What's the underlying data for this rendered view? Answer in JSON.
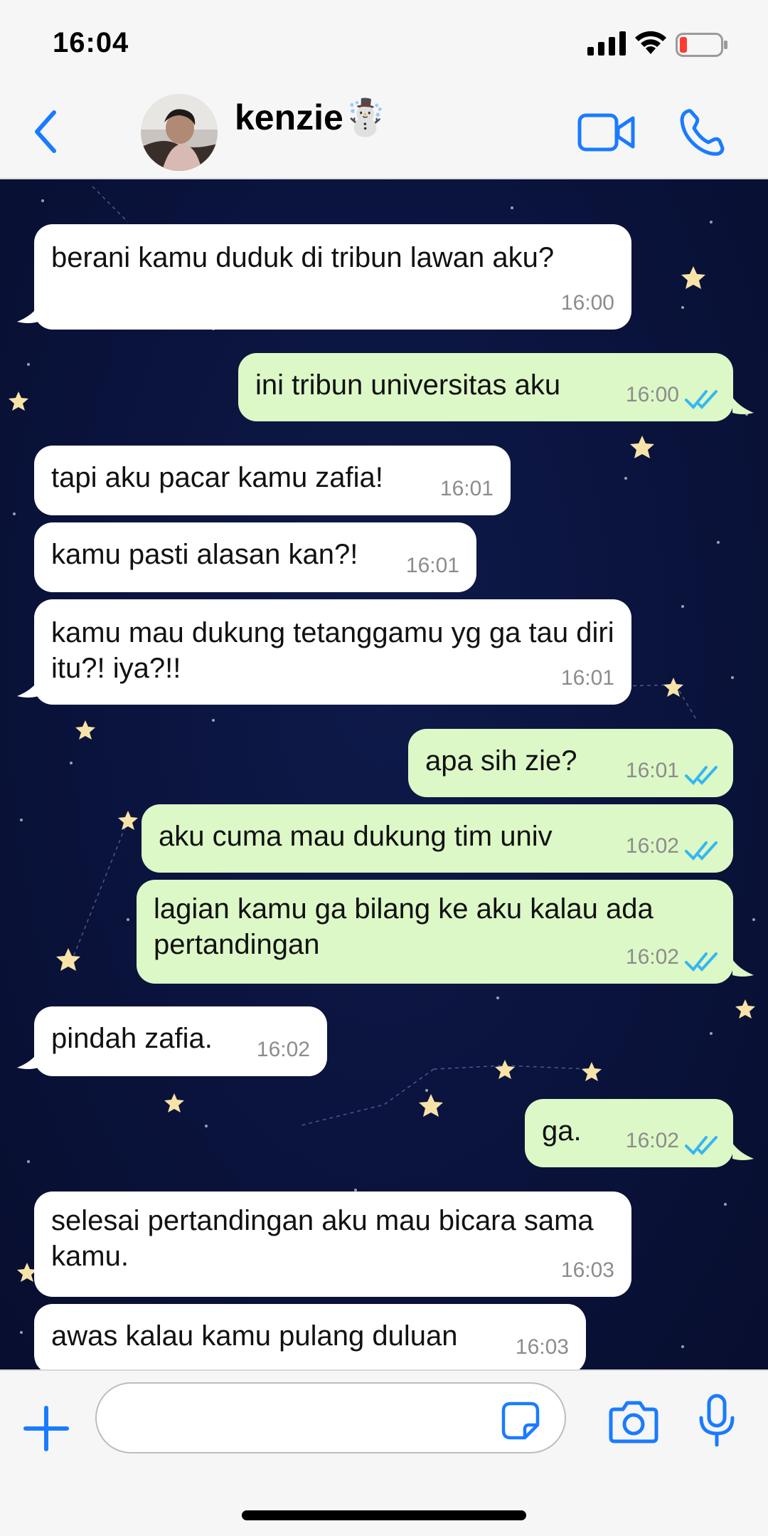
{
  "status": {
    "time": "16:04"
  },
  "header": {
    "contact_name": "kenzie☃️"
  },
  "colors": {
    "accent": "#1a7bff",
    "incoming": "#ffffff",
    "outgoing": "#dcf8c6",
    "read_ticks": "#34b7f1",
    "wallpaper": "#0a133c"
  },
  "messages": [
    {
      "dir": "in",
      "text": "berani kamu duduk di tribun lawan aku?",
      "time": "16:00"
    },
    {
      "dir": "out",
      "text": "ini tribun universitas aku",
      "time": "16:00"
    },
    {
      "dir": "in",
      "text": "tapi aku pacar kamu zafia!",
      "time": "16:01"
    },
    {
      "dir": "in",
      "text": "kamu pasti alasan kan?!",
      "time": "16:01"
    },
    {
      "dir": "in",
      "text": "kamu mau dukung tetanggamu yg ga tau diri itu?! iya?!!",
      "time": "16:01"
    },
    {
      "dir": "out",
      "text": "apa sih zie?",
      "time": "16:01"
    },
    {
      "dir": "out",
      "text": "aku cuma mau dukung tim univ",
      "time": "16:02"
    },
    {
      "dir": "out",
      "text": "lagian kamu ga bilang ke aku kalau ada pertandingan",
      "time": "16:02"
    },
    {
      "dir": "in",
      "text": "pindah zafia.",
      "time": "16:02"
    },
    {
      "dir": "out",
      "text": "ga.",
      "time": "16:02"
    },
    {
      "dir": "in",
      "text": "selesai pertandingan aku mau bicara sama kamu.",
      "time": "16:03"
    },
    {
      "dir": "in",
      "text": "awas kalau kamu pulang duluan",
      "time": "16:03"
    }
  ],
  "input": {
    "placeholder": "",
    "value": ""
  },
  "icons": [
    "back-chevron-icon",
    "video-call-icon",
    "phone-icon",
    "plus-icon",
    "sticker-icon",
    "camera-icon",
    "microphone-icon"
  ]
}
